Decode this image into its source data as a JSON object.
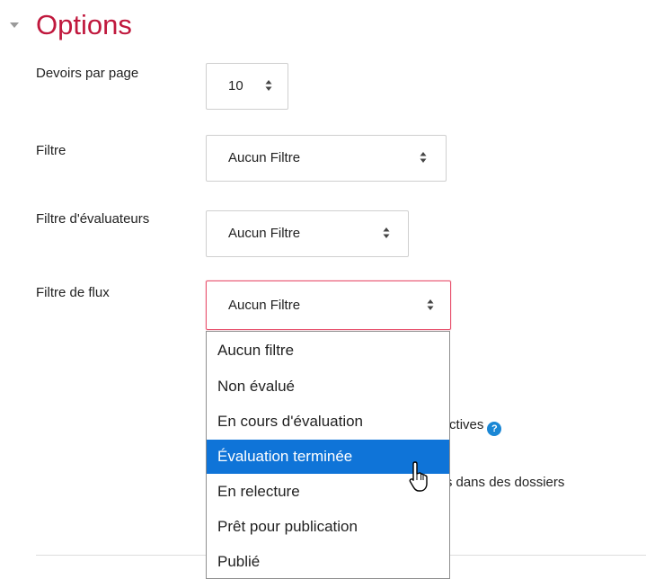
{
  "section": {
    "title": "Options"
  },
  "fields": {
    "per_page": {
      "label": "Devoirs par page",
      "value": "10"
    },
    "filter": {
      "label": "Filtre",
      "value": "Aucun Filtre"
    },
    "grader_filter": {
      "label": "Filtre d'évaluateurs",
      "value": "Aucun Filtre"
    },
    "workflow_filter": {
      "label": "Filtre de flux",
      "value": "Aucun Filtre",
      "options": [
        "Aucun filtre",
        "Non évalué",
        "En cours d'évaluation",
        "Évaluation terminée",
        "En relecture",
        "Prêt pour publication",
        "Publié"
      ],
      "highlighted_index": 3
    }
  },
  "background_texts": {
    "quick_grading_partial": "ions actives",
    "folders_partial": "mis dans des dossiers"
  },
  "icons": {
    "collapse": "triangle-down-icon",
    "select_arrows": "sort-arrows-icon",
    "help": "question-circle-icon",
    "cursor": "mouse-pointer-icon"
  },
  "colors": {
    "section_title": "#c0183d",
    "focus_border": "#e8536f",
    "highlight": "#0f74d8",
    "help_icon": "#1a87d5"
  }
}
